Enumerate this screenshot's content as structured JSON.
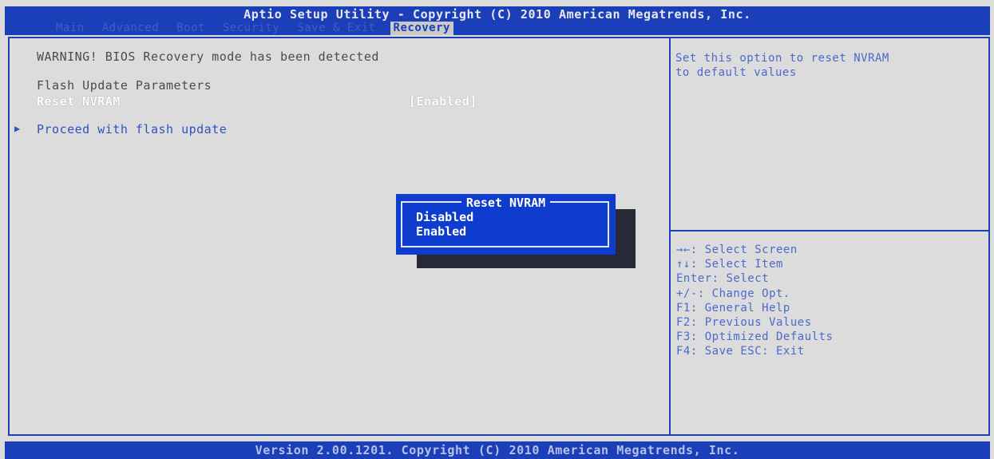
{
  "header": {
    "title": "Aptio Setup Utility - Copyright (C) 2010 American Megatrends, Inc.",
    "tabs": [
      "Main",
      "Advanced",
      "Boot",
      "Security",
      "Save & Exit",
      "Recovery"
    ],
    "active_tab": "Recovery"
  },
  "main": {
    "warning": "WARNING! BIOS Recovery mode has been detected",
    "section_title": "Flash Update Parameters",
    "reset_nvram_label": "Reset NVRAM",
    "reset_nvram_value": "[Enabled]",
    "proceed_label": "Proceed with flash update",
    "proceed_arrow": "▶"
  },
  "help": {
    "description": "Set this option to reset NVRAM\nto default values",
    "keys": [
      "→←: Select Screen",
      "↑↓: Select Item",
      "Enter: Select",
      "+/-: Change Opt.",
      "F1: General Help",
      "F2: Previous Values",
      "F3: Optimized Defaults",
      "F4: Save  ESC: Exit"
    ]
  },
  "popup": {
    "title": "Reset NVRAM",
    "options": [
      "Disabled",
      "Enabled"
    ],
    "selected": "Disabled"
  },
  "footer": {
    "text": "Version 2.00.1201. Copyright (C) 2010 American Megatrends, Inc."
  },
  "colors": {
    "bar_blue": "#1a3fb8",
    "panel_bg": "#dcdcdc",
    "popup_blue": "#0e3ccf"
  }
}
